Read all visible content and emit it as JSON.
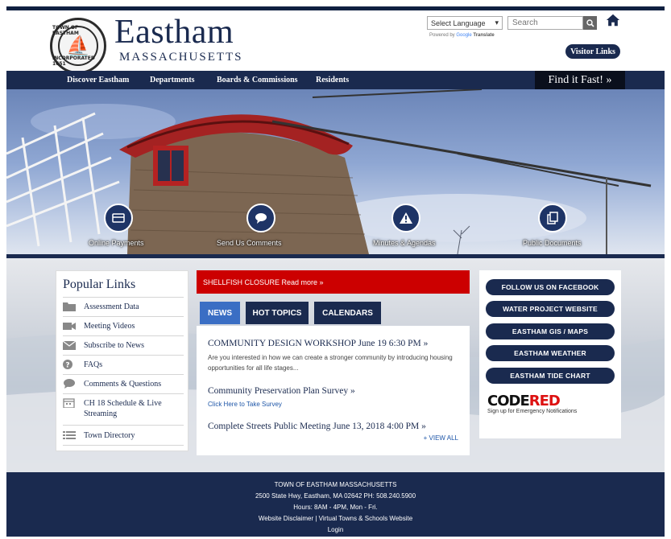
{
  "header": {
    "title": "Eastham",
    "subtitle": "MASSACHUSETTS",
    "seal_text_top": "TOWN OF EASTHAM",
    "seal_text_bottom": "INCORPORATED 1651",
    "language_select": "Select Language",
    "powered_by": "Powered by",
    "powered_google": "Google",
    "powered_translate": "Translate",
    "search_placeholder": "Search",
    "visitor_links": "Visitor Links"
  },
  "nav": {
    "items": [
      "Discover Eastham",
      "Departments",
      "Boards & Commissions",
      "Residents"
    ],
    "find_it_fast": "Find it Fast! »"
  },
  "hero": {
    "links": [
      "Online Payments",
      "Send Us Comments",
      "Minutes & Agendas",
      "Public Documents"
    ]
  },
  "popular": {
    "title": "Popular Links",
    "items": [
      {
        "label": "Assessment Data",
        "icon": "folder-icon"
      },
      {
        "label": "Meeting Videos",
        "icon": "video-icon"
      },
      {
        "label": "Subscribe to News",
        "icon": "envelope-icon"
      },
      {
        "label": "FAQs",
        "icon": "question-icon"
      },
      {
        "label": "Comments & Questions",
        "icon": "comment-icon"
      },
      {
        "label": "CH 18 Schedule & Live Streaming",
        "icon": "calendar-icon"
      },
      {
        "label": "Town Directory",
        "icon": "list-icon"
      }
    ]
  },
  "alert": "SHELLFISH CLOSURE Read more »",
  "tabs": [
    "NEWS",
    "HOT TOPICS",
    "CALENDARS"
  ],
  "news": {
    "items": [
      {
        "title": "COMMUNITY DESIGN WORKSHOP June 19 6:30 PM »",
        "desc": "Are you interested in how we can create a stronger community by introducing housing opportunities for all life stages..."
      },
      {
        "title": "Community Preservation Plan Survey »",
        "link": "Click Here to Take Survey"
      },
      {
        "title": "Complete Streets Public Meeting June 13, 2018 4:00 PM »"
      }
    ],
    "view_all": "+ VIEW ALL"
  },
  "right_panel": {
    "buttons": [
      "FOLLOW US ON FACEBOOK",
      "WATER PROJECT WEBSITE",
      "EASTHAM GIS / MAPS",
      "EASTHAM WEATHER",
      "EASTHAM TIDE CHART"
    ],
    "code": "CODE",
    "red": "RED",
    "code_sub": "Sign up for Emergency Notifications"
  },
  "footer": {
    "line1": "TOWN OF EASTHAM MASSACHUSETTS",
    "line2": "2500 State Hwy, Eastham, MA 02642 PH: 508.240.5900",
    "line3": "Hours: 8AM - 4PM, Mon - Fri.",
    "line4": "Website Disclaimer | Virtual Towns & Schools Website",
    "line5": "Login"
  },
  "colors": {
    "navy": "#1a2a4f",
    "alert_red": "#cc0000",
    "tab_blue": "#3a6ec4"
  }
}
